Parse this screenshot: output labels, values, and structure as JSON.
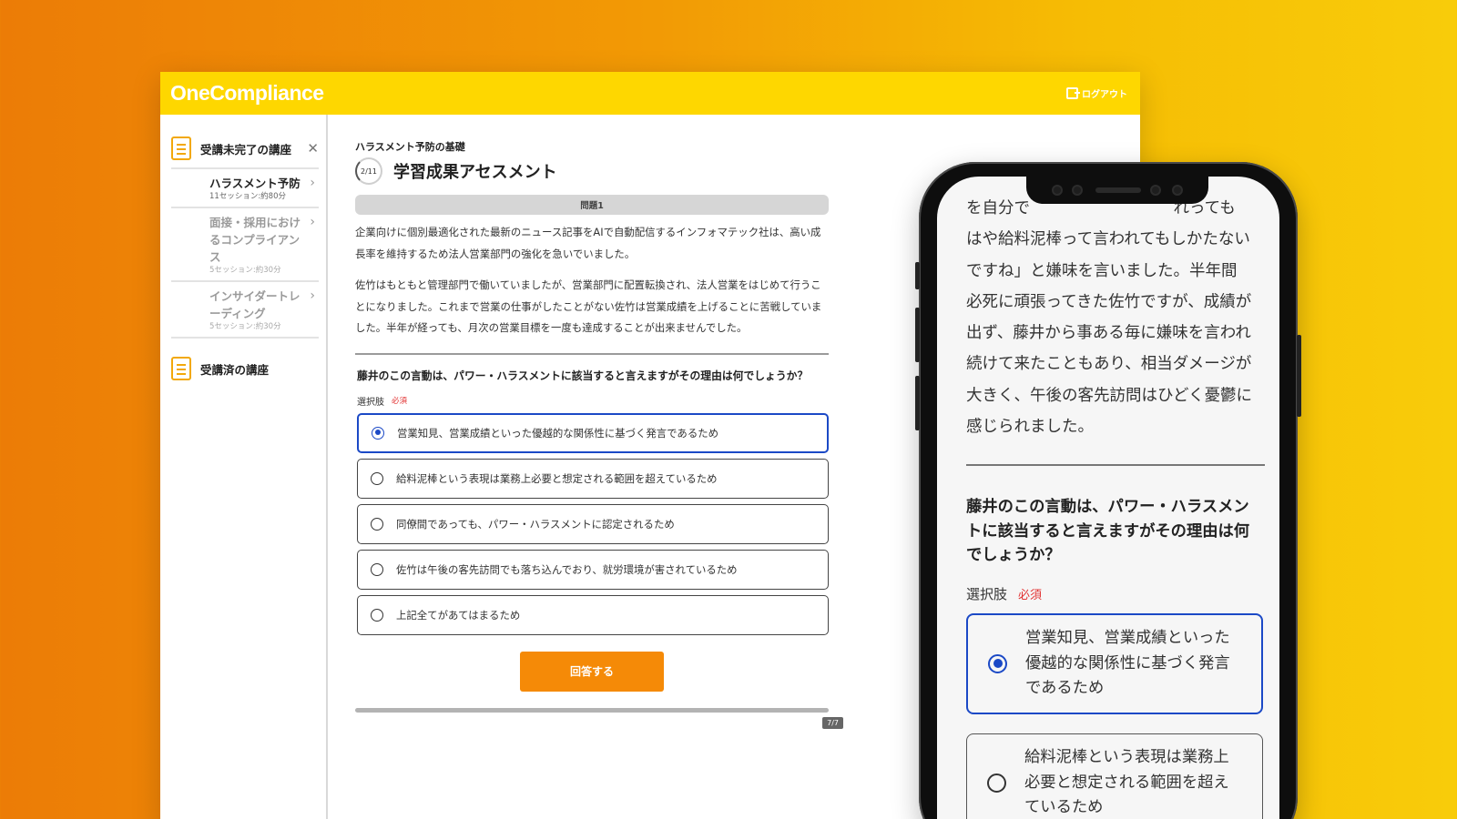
{
  "app": {
    "logo": "OneCompliance",
    "logout_label": "ログアウト"
  },
  "sidebar": {
    "incomplete_heading": "受講未完了の講座",
    "items": [
      {
        "title": "ハラスメント予防",
        "sub": "11セッション:約80分"
      },
      {
        "title": "面接・採用におけるコンプライアンス",
        "sub": "5セッション:約30分"
      },
      {
        "title": "インサイダートレーディング",
        "sub": "5セッション:約30分"
      }
    ],
    "completed_heading": "受講済の講座"
  },
  "main": {
    "course_name": "ハラスメント予防の基礎",
    "step_badge": "2/11",
    "page_title": "学習成果アセスメント",
    "question_bar": "問題1",
    "paragraphs": [
      "企業向けに個別最適化された最新のニュース記事をAIで自動配信するインフォマテック社は、高い成長率を維持するため法人営業部門の強化を急いでいました。",
      "佐竹はもともと管理部門で働いていましたが、営業部門に配置転換され、法人営業をはじめて行うことになりました。これまで営業の仕事がしたことがない佐竹は営業成績を上げることに苦戦していました。半年が経っても、月次の営業目標を一度も達成することが出来ませんでした。"
    ],
    "question": "藤井のこの言動は、パワー・ハラスメントに該当すると言えますがその理由は何でしょうか？",
    "choices_label": "選択肢",
    "required_label": "必須",
    "options": [
      "営業知見、営業成績といった優越的な関係性に基づく発言であるため",
      "給料泥棒という表現は業務上必要と想定される範囲を超えているため",
      "同僚間であっても、パワー・ハラスメントに認定されるため",
      "佐竹は午後の客先訪問でも落ち込んでおり、就労環境が害されているため",
      "上記全てがあてはまるため"
    ],
    "selected_index": 0,
    "submit_label": "回答する",
    "progress_label": "7/7",
    "progress": 1.0
  },
  "mobile": {
    "text": "を自分で　　　　　　　　　れっても\nはや給料泥棒って言われてもしかたない\nですね」と嫌味を言いました。半年間\n必死に頑張ってきた佐竹ですが、成績が\n出ず、藤井から事ある毎に嫌味を言われ\n続けて来たこともあり、相当ダメージが\n大きく、午後の客先訪問はひどく憂鬱に\n感じられました。",
    "question": "藤井のこの言動は、パワー・ハラスメントに該当すると言えますがその理由は何でしょうか？",
    "choices_label": "選択肢",
    "required_label": "必須",
    "options": [
      "営業知見、営業成績といった優越的な関係性に基づく発言であるため",
      "給料泥棒という表現は業務上必要と想定される範囲を超えているため"
    ]
  },
  "colors": {
    "brand_yellow": "#fed700",
    "accent_orange": "#f58a07",
    "selected_blue": "#1b49c6",
    "required_red": "#e23333"
  }
}
